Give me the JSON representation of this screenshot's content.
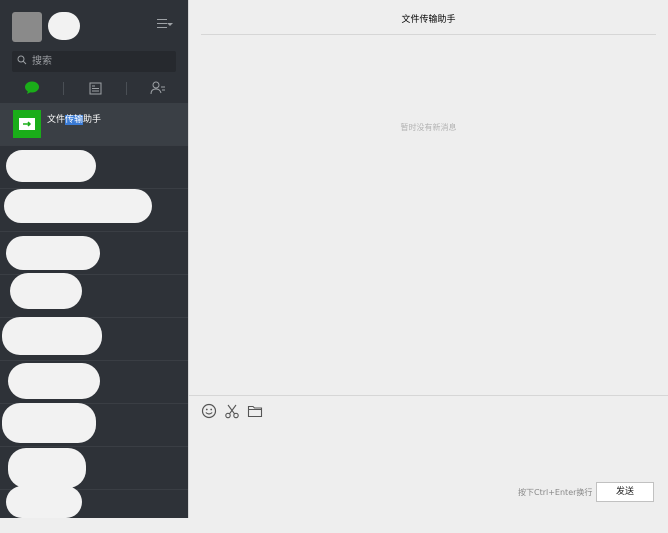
{
  "search": {
    "placeholder": "搜索"
  },
  "chat_list": {
    "active_chat": {
      "title": "文件传输助手",
      "highlight": "传输"
    }
  },
  "conversation": {
    "title": "文件传输助手",
    "empty_message": "暂时没有新消息"
  },
  "composer": {
    "hint": "按下Ctrl+Enter换行",
    "send_label": "发送"
  },
  "colors": {
    "sidebar_bg": "#2e3238",
    "accent_green": "#1aad19",
    "main_bg": "#eeeeee"
  }
}
